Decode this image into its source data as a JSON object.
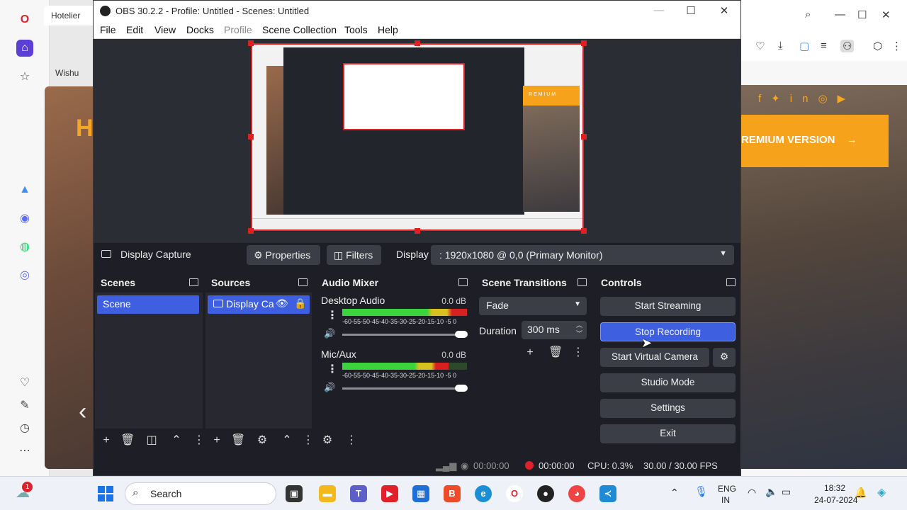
{
  "background": {
    "tab_title": "Hotelier",
    "wishlist_text": "Wishu",
    "hero_letter": "H",
    "premium_banner": "REMIUM VERSION",
    "social_icons": [
      "facebook-icon",
      "twitter-icon",
      "linkedin-icon",
      "instagram-icon",
      "youtube-icon"
    ]
  },
  "obs": {
    "title": "OBS 30.2.2 - Profile: Untitled - Scenes: Untitled",
    "menu": [
      "File",
      "Edit",
      "View",
      "Docks",
      "Profile",
      "Scene Collection",
      "Tools",
      "Help"
    ],
    "source_toolbar": {
      "source_name": "Display Capture",
      "properties_label": "Properties",
      "filters_label": "Filters",
      "display_label": "Display",
      "display_value": ": 1920x1080 @ 0,0 (Primary Monitor)"
    },
    "docks": {
      "scenes": {
        "title": "Scenes",
        "items": [
          "Scene"
        ]
      },
      "sources": {
        "title": "Sources",
        "items": [
          "Display Ca"
        ]
      },
      "audio_mixer": {
        "title": "Audio Mixer",
        "channels": [
          {
            "name": "Desktop Audio",
            "db": "0.0 dB",
            "level": 1.0
          },
          {
            "name": "Mic/Aux",
            "db": "0.0 dB",
            "level": 0.85
          }
        ],
        "scale": "-60-55-50-45-40-35-30-25-20-15-10 -5  0"
      },
      "scene_transitions": {
        "title": "Scene Transitions",
        "transition": "Fade",
        "duration_label": "Duration",
        "duration_value": "300 ms"
      },
      "controls": {
        "title": "Controls",
        "buttons": [
          "Start Streaming",
          "Stop Recording",
          "Start Virtual Camera",
          "Studio Mode",
          "Settings",
          "Exit"
        ],
        "active_button": "Stop Recording"
      }
    },
    "status": {
      "stream_time": "00:00:00",
      "rec_time": "00:00:00",
      "cpu": "CPU: 0.3%",
      "fps": "30.00 / 30.00 FPS"
    }
  },
  "taskbar": {
    "search_label": "Search",
    "notification_count": "1",
    "lang_line1": "ENG",
    "lang_line2": "IN",
    "time": "18:32",
    "date": "24-07-2024"
  },
  "colors": {
    "obs_bg": "#1e1f26",
    "obs_panel": "#272830",
    "obs_accent": "#3d5fe0",
    "rec_red": "#e0202a",
    "banner_orange": "#f7a21b"
  }
}
